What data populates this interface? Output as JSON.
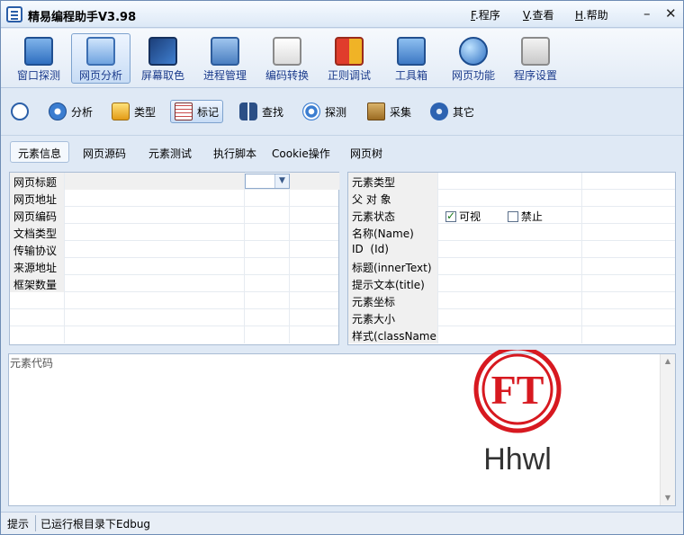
{
  "titlebar": {
    "title": "精易编程助手V3.98",
    "menu": [
      {
        "key": "F",
        "label": ".程序"
      },
      {
        "key": "V",
        "label": ".查看"
      },
      {
        "key": "H",
        "label": ".帮助"
      }
    ],
    "minimize": "–",
    "close": "✕"
  },
  "toolbar_main": {
    "items": [
      {
        "label": "窗口探测",
        "icon": "window-detect-icon"
      },
      {
        "label": "网页分析",
        "icon": "web-analysis-icon"
      },
      {
        "label": "屏幕取色",
        "icon": "color-picker-icon"
      },
      {
        "label": "进程管理",
        "icon": "process-manager-icon"
      },
      {
        "label": "编码转换",
        "icon": "encoding-convert-icon"
      },
      {
        "label": "正则调试",
        "icon": "regex-debug-icon"
      },
      {
        "label": "工具箱",
        "icon": "toolbox-icon"
      },
      {
        "label": "网页功能",
        "icon": "web-function-icon"
      },
      {
        "label": "程序设置",
        "icon": "settings-icon"
      }
    ]
  },
  "toolbar_sub": {
    "items": [
      {
        "label": "分析",
        "icon": "analyze-icon"
      },
      {
        "label": "类型",
        "icon": "type-icon"
      },
      {
        "label": "标记",
        "icon": "mark-icon"
      },
      {
        "label": "查找",
        "icon": "find-icon"
      },
      {
        "label": "探测",
        "icon": "probe-icon"
      },
      {
        "label": "采集",
        "icon": "collect-icon"
      },
      {
        "label": "其它",
        "icon": "other-icon"
      }
    ]
  },
  "tabs": [
    "元素信息",
    "网页源码",
    "元素测试",
    "执行脚本",
    "Cookie操作",
    "网页树"
  ],
  "left_grid": {
    "rows": [
      "网页标题",
      "网页地址",
      "网页编码",
      "文档类型",
      "传输协议",
      "来源地址",
      "框架数量",
      "",
      "",
      "",
      ""
    ]
  },
  "right_grid": {
    "rows": [
      "元素类型",
      "父 对 象",
      "元素状态",
      "名称(Name)",
      "ID  (Id)",
      "标题(innerText)",
      "提示文本(title)",
      "元素坐标",
      "元素大小",
      "样式(className)"
    ],
    "state_visible": "可视",
    "state_disabled": "禁止"
  },
  "code_area": {
    "label": "元素代码",
    "logo_text": "Hhwl",
    "logo_mark": "FT"
  },
  "statusbar": {
    "label": "提示",
    "message": "已运行根目录下Edbug"
  }
}
